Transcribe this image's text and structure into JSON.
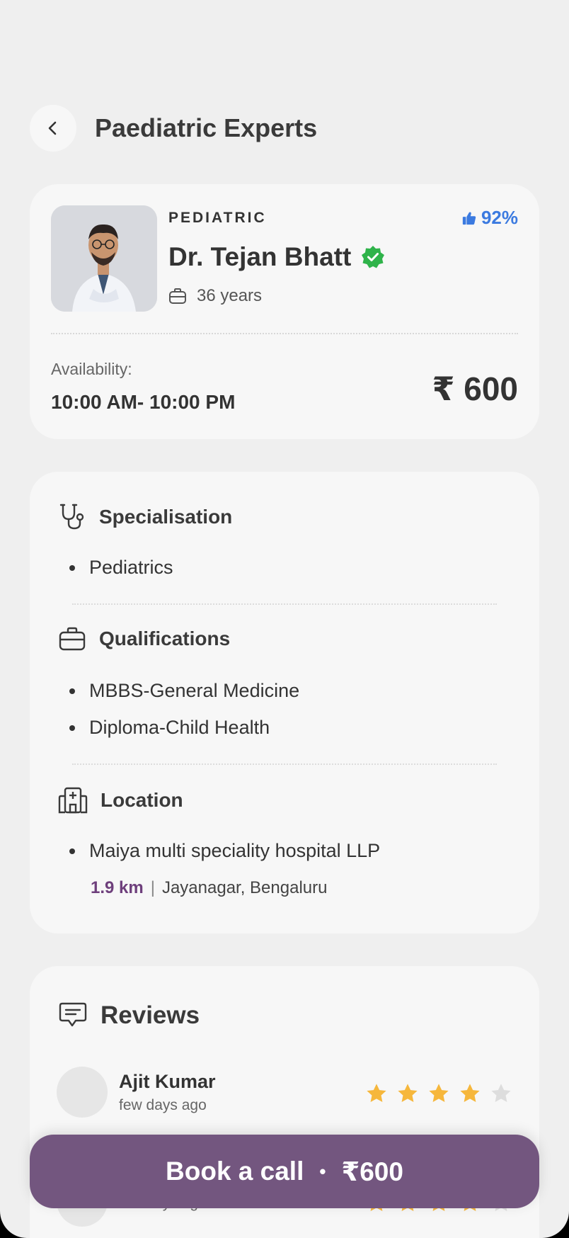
{
  "header": {
    "title": "Paediatric Experts"
  },
  "doctor": {
    "specialty": "PEDIATRIC",
    "rating": "92%",
    "name": "Dr. Tejan Bhatt",
    "experience": "36 years",
    "availability_label": "Availability:",
    "availability_time": "10:00 AM- 10:00 PM",
    "price": "₹ 600"
  },
  "details": {
    "specialisation": {
      "title": "Specialisation",
      "items": [
        "Pediatrics"
      ]
    },
    "qualifications": {
      "title": "Qualifications",
      "items": [
        "MBBS-General Medicine",
        "Diploma-Child Health"
      ]
    },
    "location": {
      "title": "Location",
      "hospital": "Maiya multi speciality hospital LLP",
      "distance": "1.9 km",
      "separator": "|",
      "area": "Jayanagar, Bengaluru"
    }
  },
  "reviews": {
    "title": "Reviews",
    "items": [
      {
        "name": "Ajit Kumar",
        "time": "few days ago",
        "rating": 4
      },
      {
        "name": "",
        "time": "few days ago",
        "rating": 4
      }
    ]
  },
  "cta": {
    "label": "Book a call",
    "separator": "•",
    "price": "₹600"
  },
  "colors": {
    "accent": "#73567f",
    "rating_blue": "#3b7ae0",
    "verified_green": "#2fb34a",
    "star": "#f6b73c",
    "star_empty": "#dddddd"
  },
  "icons": [
    "chevron-left-icon",
    "thumbs-up-icon",
    "verified-badge-icon",
    "briefcase-icon",
    "stethoscope-icon",
    "hospital-icon",
    "chat-icon",
    "star-icon"
  ]
}
